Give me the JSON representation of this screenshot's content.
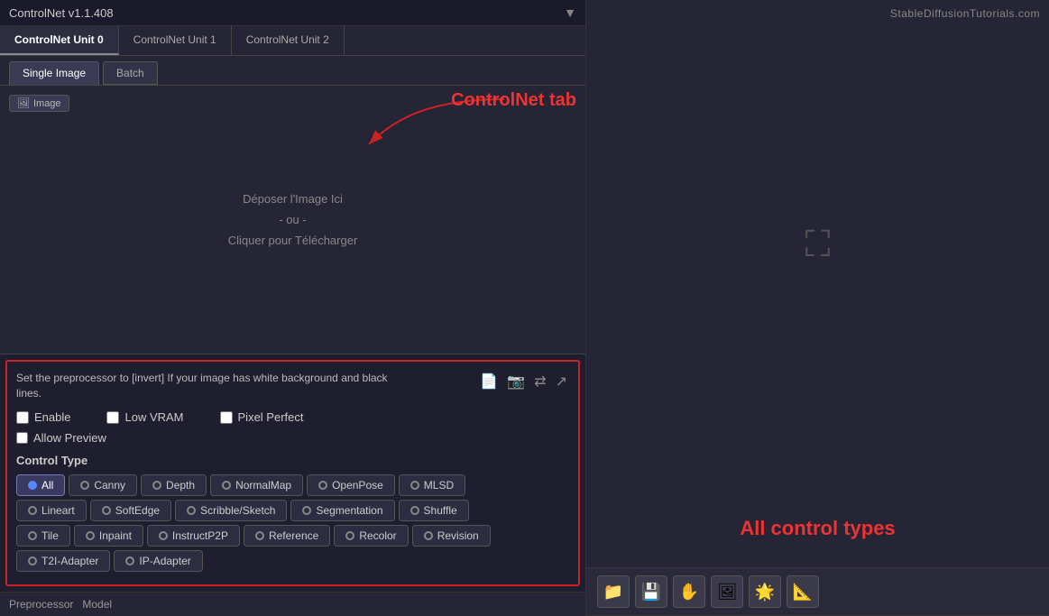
{
  "app": {
    "title": "ControlNet v1.1.408",
    "watermark": "StableDiffusionTutorials.com"
  },
  "unit_tabs": [
    {
      "label": "ControlNet Unit 0",
      "active": true
    },
    {
      "label": "ControlNet Unit 1",
      "active": false
    },
    {
      "label": "ControlNet Unit 2",
      "active": false
    }
  ],
  "mode_tabs": [
    {
      "label": "Single Image",
      "active": true
    },
    {
      "label": "Batch",
      "active": false
    }
  ],
  "image_label": "Image",
  "upload": {
    "line1": "Déposer l'Image Ici",
    "line2": "- ou -",
    "line3": "Cliquer pour Télécharger"
  },
  "annotation": {
    "arrow_text": "ControlNet tab"
  },
  "info_text": "Set the preprocessor to [invert] If your image has white background and black lines.",
  "checkboxes": [
    {
      "label": "Enable",
      "checked": false
    },
    {
      "label": "Low VRAM",
      "checked": false
    },
    {
      "label": "Pixel Perfect",
      "checked": false
    }
  ],
  "allow_preview": {
    "label": "Allow Preview",
    "checked": false
  },
  "control_type": {
    "label": "Control Type",
    "items": [
      {
        "label": "All",
        "active": true
      },
      {
        "label": "Canny",
        "active": false
      },
      {
        "label": "Depth",
        "active": false
      },
      {
        "label": "NormalMap",
        "active": false
      },
      {
        "label": "OpenPose",
        "active": false
      },
      {
        "label": "MLSD",
        "active": false
      },
      {
        "label": "Lineart",
        "active": false
      },
      {
        "label": "SoftEdge",
        "active": false
      },
      {
        "label": "Scribble/Sketch",
        "active": false
      },
      {
        "label": "Segmentation",
        "active": false
      },
      {
        "label": "Shuffle",
        "active": false
      },
      {
        "label": "Tile",
        "active": false
      },
      {
        "label": "Inpaint",
        "active": false
      },
      {
        "label": "InstructP2P",
        "active": false
      },
      {
        "label": "Reference",
        "active": false
      },
      {
        "label": "Recolor",
        "active": false
      },
      {
        "label": "Revision",
        "active": false
      },
      {
        "label": "T2I-Adapter",
        "active": false
      },
      {
        "label": "IP-Adapter",
        "active": false
      }
    ]
  },
  "bottom_row": {
    "preprocessor_label": "Preprocessor",
    "model_label": "Model"
  },
  "right_annotation": "All control types",
  "toolbar_icons": [
    "📁",
    "💾",
    "✋",
    "🖼️",
    "🌟",
    "📐"
  ]
}
